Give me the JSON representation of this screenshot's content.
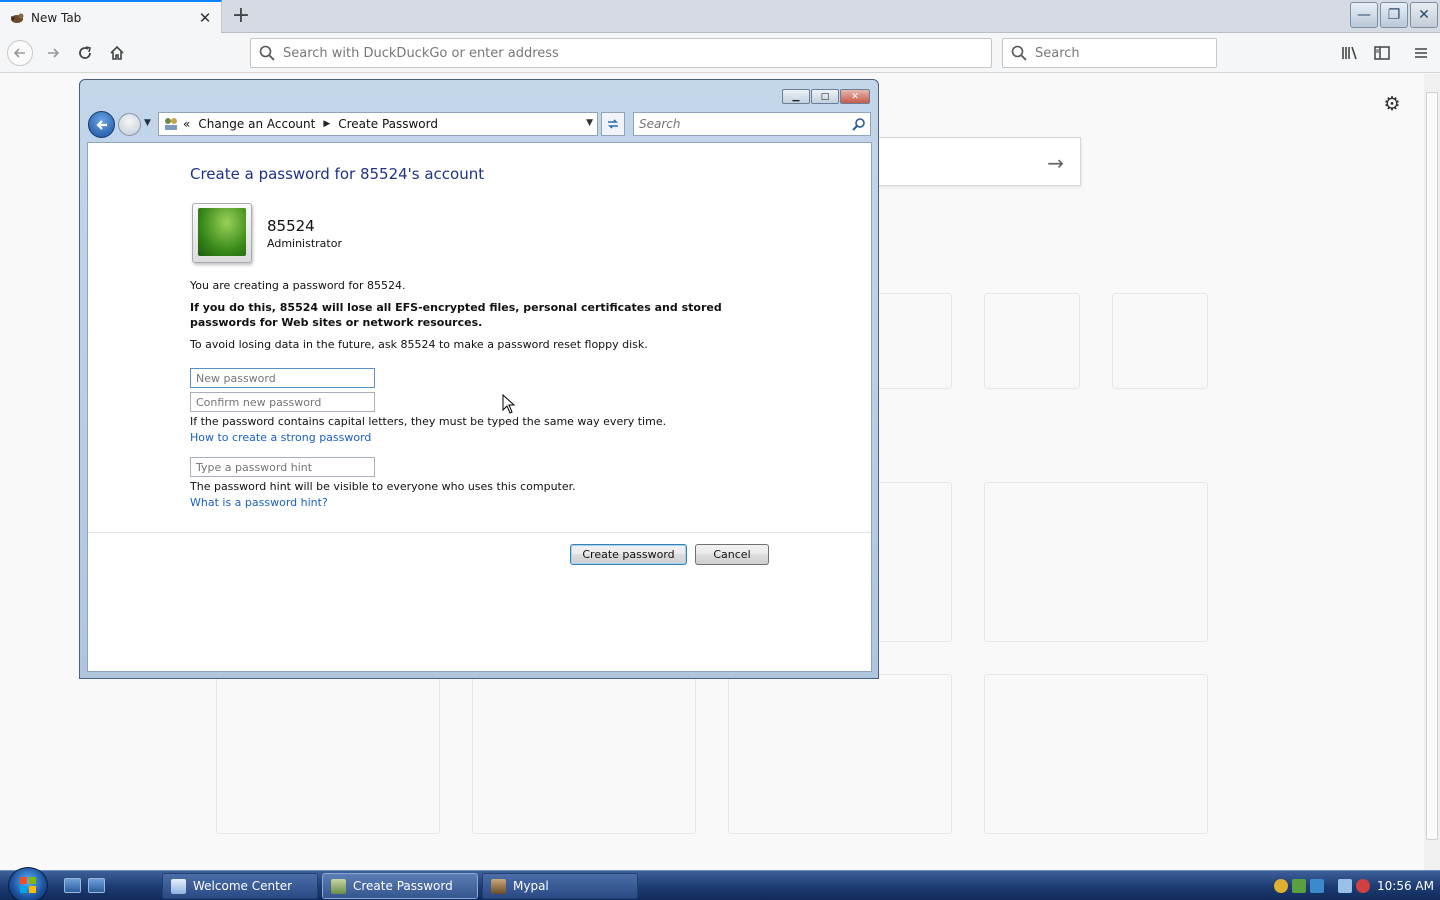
{
  "browser": {
    "tab": {
      "title": "New Tab",
      "close_glyph": "✕",
      "favicon": "mypal-icon"
    },
    "new_tab_glyph": "+",
    "url_placeholder": "Search with DuckDuckGo or enter address",
    "search_placeholder": "Search",
    "window_buttons": {
      "minimize": "—",
      "restore": "❐",
      "close": "✕"
    },
    "accent": "#0a84ff"
  },
  "newtab": {
    "search_arrow": "→",
    "gear": "⚙"
  },
  "dialog": {
    "caption_buttons": {
      "minimize": "▁",
      "maximize": "□",
      "close": "✕"
    },
    "breadcrumb": {
      "lead": "«",
      "item1": "Change an Account",
      "sep": "▶",
      "item2": "Create Password",
      "dropdown": "▼"
    },
    "search_placeholder": "Search",
    "heading": "Create a password for 85524's account",
    "user": {
      "name": "85524",
      "role": "Administrator"
    },
    "info1": "You are creating a password for 85524.",
    "warning": "If you do this, 85524 will lose all EFS-encrypted files, personal certificates and stored passwords for Web sites or network resources.",
    "info2": "To avoid losing data in the future, ask 85524 to make a password reset floppy disk.",
    "new_password_placeholder": "New password",
    "confirm_password_placeholder": "Confirm new password",
    "caps_note": "If the password contains capital letters, they must be typed the same way every time.",
    "strong_link": "How to create a strong password",
    "hint_placeholder": "Type a password hint",
    "hint_note": "The password hint will be visible to everyone who uses this computer.",
    "hint_link": "What is a password hint?",
    "create_button": "Create password",
    "cancel_button": "Cancel",
    "heading_color": "#1e3287",
    "link_color": "#1a5fc4"
  },
  "taskbar": {
    "tasks": [
      {
        "label": "Welcome Center",
        "icon": "welcome-center-icon"
      },
      {
        "label": "Create Password",
        "icon": "control-panel-icon"
      },
      {
        "label": "Mypal",
        "icon": "mypal-icon"
      }
    ],
    "clock": "10:56 AM"
  }
}
